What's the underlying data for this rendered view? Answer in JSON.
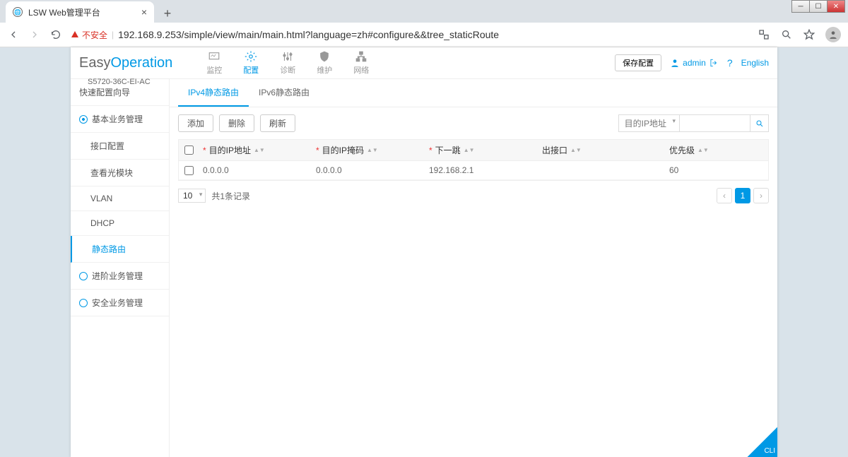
{
  "browser": {
    "tab_title": "LSW Web管理平台",
    "url": "192.168.9.253/simple/view/main/main.html?language=zh#configure&&tree_staticRoute",
    "insecure_label": "不安全"
  },
  "header": {
    "brand_easy": "Easy",
    "brand_op": "Operation",
    "model": "S5720-36C-EI-AC",
    "tabs": [
      {
        "label": "监控"
      },
      {
        "label": "配置"
      },
      {
        "label": "诊断"
      },
      {
        "label": "维护"
      },
      {
        "label": "网络"
      }
    ],
    "save_config": "保存配置",
    "user": "admin",
    "help": "?",
    "lang": "English"
  },
  "sidebar": {
    "items": [
      {
        "label": "快速配置向导",
        "type": "parent"
      },
      {
        "label": "基本业务管理",
        "type": "parent"
      },
      {
        "label": "接口配置",
        "type": "child"
      },
      {
        "label": "查看光模块",
        "type": "child"
      },
      {
        "label": "VLAN",
        "type": "child"
      },
      {
        "label": "DHCP",
        "type": "child"
      },
      {
        "label": "静态路由",
        "type": "child",
        "active": true
      },
      {
        "label": "进阶业务管理",
        "type": "parent"
      },
      {
        "label": "安全业务管理",
        "type": "parent"
      }
    ]
  },
  "subtabs": {
    "items": [
      {
        "label": "IPv4静态路由",
        "active": true
      },
      {
        "label": "IPv6静态路由"
      }
    ]
  },
  "toolbar": {
    "add": "添加",
    "delete": "删除",
    "refresh": "刷新",
    "search_select": "目的IP地址"
  },
  "table": {
    "columns": {
      "dst": "目的IP地址",
      "mask": "目的IP掩码",
      "next": "下一跳",
      "iface": "出接口",
      "prio": "优先级"
    },
    "rows": [
      {
        "dst": "0.0.0.0",
        "mask": "0.0.0.0",
        "next": "192.168.2.1",
        "iface": "",
        "prio": "60"
      }
    ]
  },
  "pager": {
    "page_size": "10",
    "record_info": "共1条记录",
    "current": "1",
    "prev": "‹",
    "next": "›"
  },
  "cli_label": "CLI"
}
